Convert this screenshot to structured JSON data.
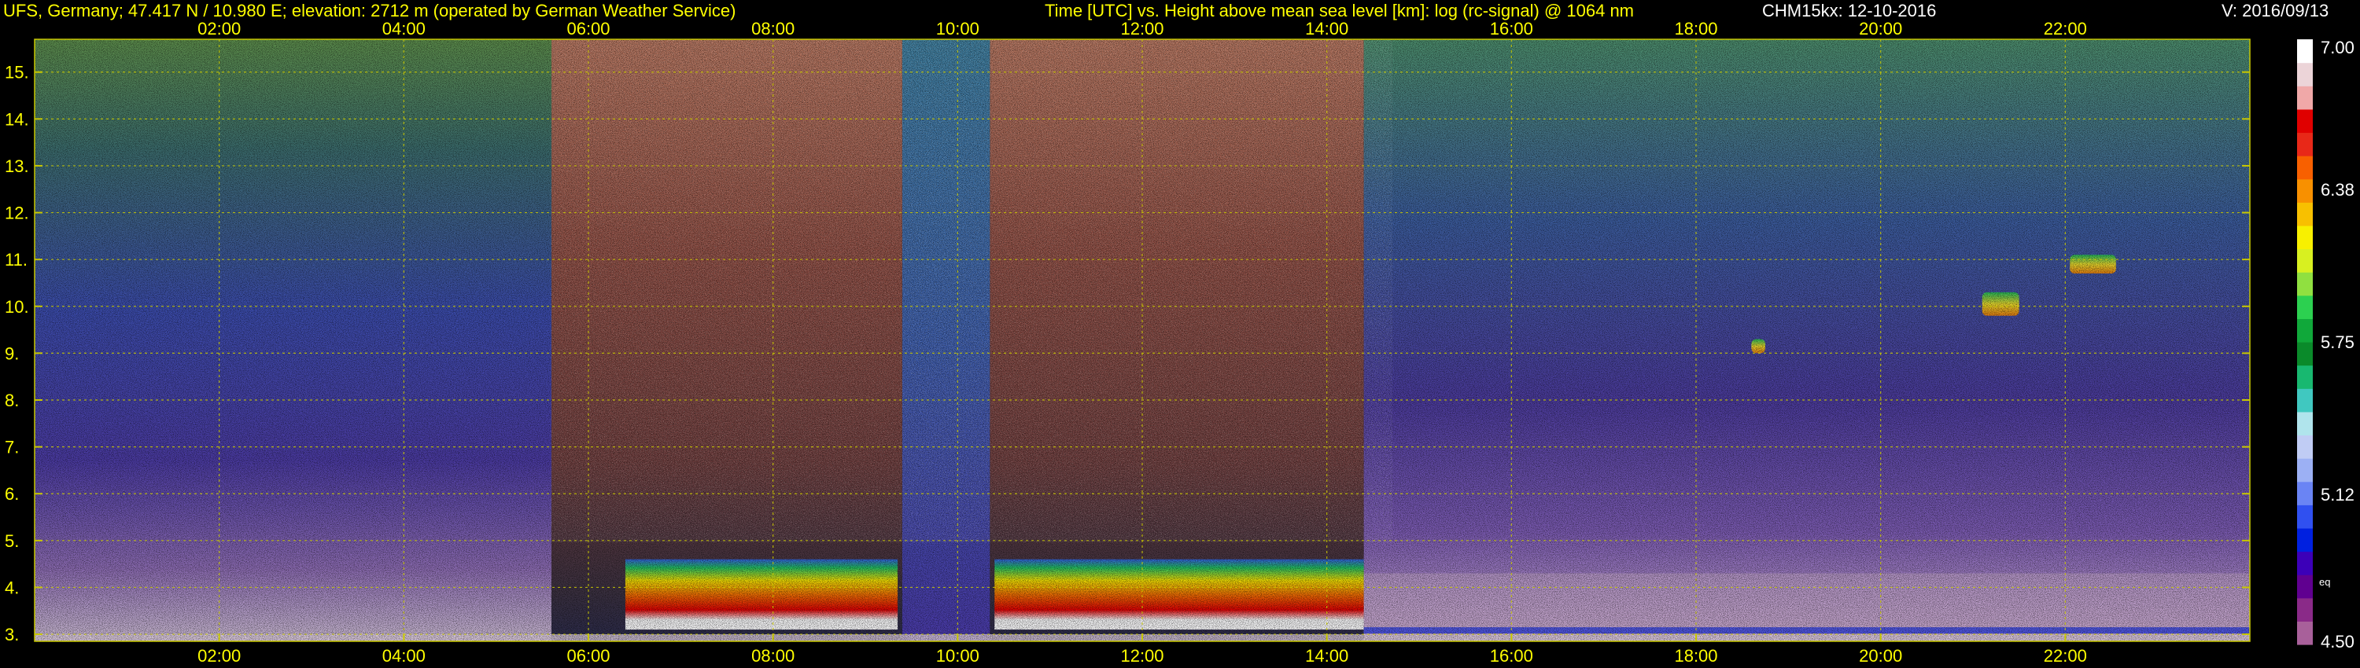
{
  "header": {
    "station": "UFS, Germany; 47.417 N / 10.980 E; elevation: 2712 m  (operated by German Weather Service)",
    "description": "Time [UTC] vs. Height above mean sea level [km]: log (rc-signal) @ 1064 nm",
    "instrument_date": "CHM15kx: 12-10-2016",
    "version": "V: 2016/09/13"
  },
  "colors": {
    "background": "#000000",
    "title_text": "#ffff00",
    "white_text": "#ffffff",
    "grid": "#c8c800",
    "ground_strip": "#d8c8d8"
  },
  "chart_data": {
    "type": "heatmap",
    "xlabel": "Time [UTC]",
    "ylabel": "Height above mean sea level [km]",
    "x_range_hours": [
      0.0,
      24.0
    ],
    "y_range_km": [
      2.85,
      15.7
    ],
    "x_ticks": [
      "02:00",
      "04:00",
      "06:00",
      "08:00",
      "10:00",
      "12:00",
      "14:00",
      "16:00",
      "18:00",
      "20:00",
      "22:00"
    ],
    "x_tick_hours": [
      2,
      4,
      6,
      8,
      10,
      12,
      14,
      16,
      18,
      20,
      22
    ],
    "y_ticks": [
      "3.",
      "4.",
      "5.",
      "6.",
      "7.",
      "8.",
      "9.",
      "10.",
      "11.",
      "12.",
      "13.",
      "14.",
      "15."
    ],
    "y_tick_km": [
      3,
      4,
      5,
      6,
      7,
      8,
      9,
      10,
      11,
      12,
      13,
      14,
      15
    ],
    "grid": true,
    "colorbar": {
      "min": 4.5,
      "max": 7.0,
      "tick_labels": [
        "7.00",
        "6.38",
        "5.75",
        "5.12",
        "4.50"
      ],
      "tick_values": [
        7.0,
        6.38,
        5.75,
        5.12,
        4.5
      ],
      "extra_label": "eq",
      "colors": [
        "#a8609a",
        "#8a2a88",
        "#600090",
        "#3c00b8",
        "#0020e0",
        "#3050f0",
        "#6a84f4",
        "#9cb0f4",
        "#c0ccf4",
        "#b0e4ec",
        "#40c8c0",
        "#18b870",
        "#0a8a2a",
        "#10a83a",
        "#2cd050",
        "#90e040",
        "#d8f020",
        "#f8f000",
        "#f8c000",
        "#f89000",
        "#f86000",
        "#e82818",
        "#e00000",
        "#f0a8a8",
        "#ecd4d8",
        "#ffffff"
      ]
    },
    "time_periods": [
      {
        "start": 0.0,
        "end": 5.6,
        "signal": "low-level noise; bright noise near ground"
      },
      {
        "start": 5.6,
        "end": 9.4,
        "signal": "high noise aloft; boundary layer 3.0-4.6 km"
      },
      {
        "start": 9.4,
        "end": 10.35,
        "signal": "reduced noise; no layer"
      },
      {
        "start": 10.35,
        "end": 14.4,
        "signal": "high noise aloft; boundary layer 3.0-4.6 km"
      },
      {
        "start": 14.4,
        "end": 24.0,
        "signal": "low noise; stable layer below 4.3 km"
      }
    ],
    "features": [
      {
        "name": "boundary layer",
        "t_start": 6.4,
        "t_end": 9.35,
        "z_bottom": 3.1,
        "z_top": 4.6
      },
      {
        "name": "boundary layer",
        "t_start": 10.4,
        "t_end": 14.4,
        "z_bottom": 3.1,
        "z_top": 4.6
      },
      {
        "name": "aerosol patch",
        "t_start": 21.1,
        "t_end": 21.5,
        "z_bottom": 9.8,
        "z_top": 10.3
      },
      {
        "name": "aerosol patch",
        "t_start": 22.05,
        "t_end": 22.55,
        "z_bottom": 10.7,
        "z_top": 11.1
      },
      {
        "name": "aerosol patch",
        "t_start": 18.6,
        "t_end": 18.75,
        "z_bottom": 9.0,
        "z_top": 9.3
      }
    ]
  }
}
